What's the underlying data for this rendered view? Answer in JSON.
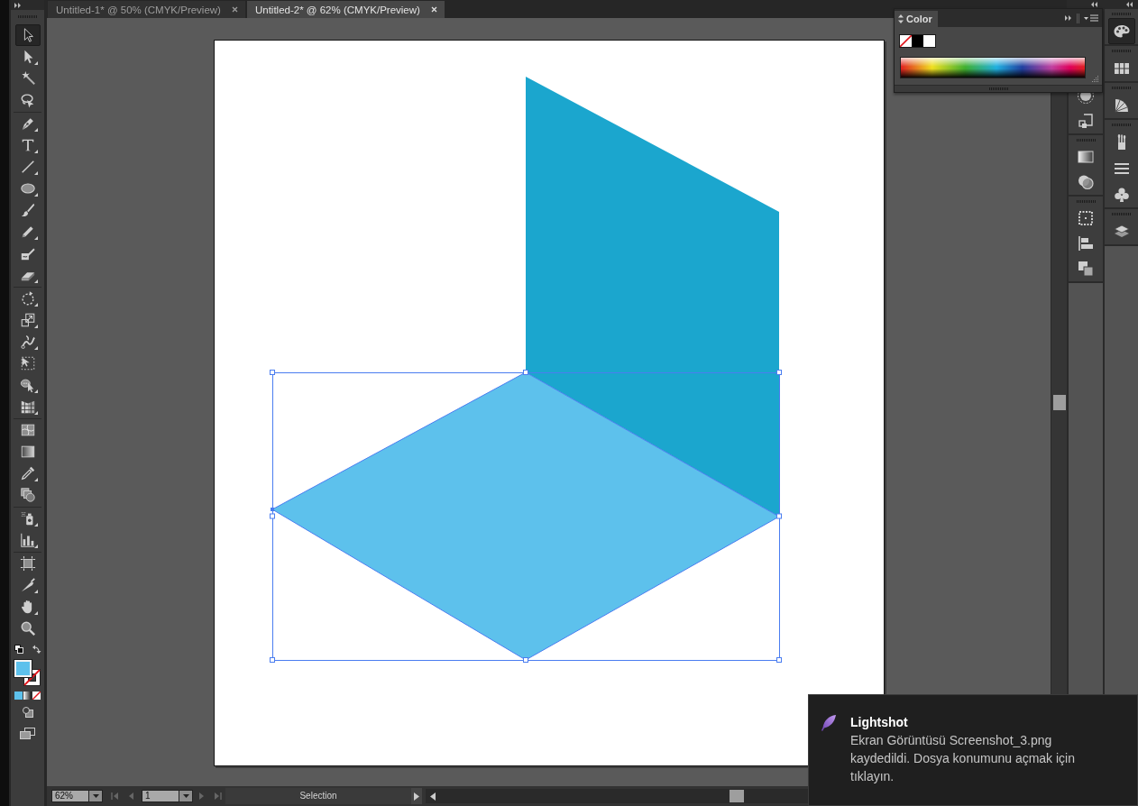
{
  "toolbar": {
    "groups": [
      {
        "tools": [
          {
            "kind": "selection",
            "selected": true,
            "flyout": false
          },
          {
            "kind": "direct",
            "selected": false,
            "flyout": true
          },
          {
            "kind": "magic_wand",
            "selected": false,
            "flyout": false
          },
          {
            "kind": "lasso",
            "selected": false,
            "flyout": false
          }
        ]
      },
      {
        "tools": [
          {
            "kind": "pen",
            "selected": false,
            "flyout": true
          },
          {
            "kind": "type",
            "selected": false,
            "flyout": true
          },
          {
            "kind": "line",
            "selected": false,
            "flyout": true
          },
          {
            "kind": "ellipse",
            "selected": false,
            "flyout": true
          },
          {
            "kind": "paintbrush",
            "selected": false,
            "flyout": false
          },
          {
            "kind": "pencil",
            "selected": false,
            "flyout": true
          },
          {
            "kind": "blob_brush",
            "selected": false,
            "flyout": false
          },
          {
            "kind": "eraser",
            "selected": false,
            "flyout": true
          }
        ]
      },
      {
        "tools": [
          {
            "kind": "rotate",
            "selected": false,
            "flyout": true
          },
          {
            "kind": "scale",
            "selected": false,
            "flyout": true
          },
          {
            "kind": "warp",
            "selected": false,
            "flyout": true
          },
          {
            "kind": "free_transform",
            "selected": false,
            "flyout": false
          },
          {
            "kind": "shape_builder",
            "selected": false,
            "flyout": true
          },
          {
            "kind": "perspective_grid",
            "selected": false,
            "flyout": true
          }
        ]
      },
      {
        "tools": [
          {
            "kind": "mesh",
            "selected": false,
            "flyout": false
          },
          {
            "kind": "gradient",
            "selected": false,
            "flyout": false
          },
          {
            "kind": "eyedropper",
            "selected": false,
            "flyout": true
          },
          {
            "kind": "blend",
            "selected": false,
            "flyout": false
          }
        ]
      },
      {
        "tools": [
          {
            "kind": "symbol_sprayer",
            "selected": false,
            "flyout": true
          },
          {
            "kind": "column_graph",
            "selected": false,
            "flyout": true
          }
        ]
      },
      {
        "tools": [
          {
            "kind": "artboard",
            "selected": false,
            "flyout": false
          },
          {
            "kind": "slice",
            "selected": false,
            "flyout": true
          },
          {
            "kind": "hand",
            "selected": false,
            "flyout": true
          },
          {
            "kind": "zoom",
            "selected": false,
            "flyout": false
          }
        ]
      }
    ],
    "fill": {
      "kind": "color",
      "color": "#5dc1ec"
    },
    "stroke": {
      "kind": "none"
    }
  },
  "tabs": [
    {
      "label": "Untitled-1* @ 50% (CMYK/Preview)",
      "selected": false
    },
    {
      "label": "Untitled-2* @ 62% (CMYK/Preview)",
      "selected": true
    }
  ],
  "artwork": {
    "shapes": [
      {
        "kind": "parallelogram",
        "color": "#1ba6ce",
        "selected": false
      },
      {
        "kind": "rhombus",
        "color": "#5dc1ec",
        "selected": true
      }
    ]
  },
  "color_panel": {
    "title": "Color",
    "swatches": [
      {
        "kind": "none"
      },
      {
        "kind": "color",
        "color": "#000000"
      },
      {
        "kind": "color",
        "color": "#ffffff"
      }
    ]
  },
  "docks": [
    {
      "groups": [
        {
          "icons": [
            {
              "kind": "appearance",
              "selected": false
            },
            {
              "kind": "transform",
              "selected": false
            }
          ]
        },
        {
          "icons": [
            {
              "kind": "gradient",
              "selected": false
            },
            {
              "kind": "transparency",
              "selected": false
            }
          ]
        },
        {
          "icons": [
            {
              "kind": "artboards",
              "selected": false
            },
            {
              "kind": "align",
              "selected": false
            },
            {
              "kind": "pathfinder",
              "selected": false
            }
          ]
        }
      ]
    },
    {
      "groups": [
        {
          "icons": [
            {
              "kind": "color",
              "selected": true
            }
          ]
        },
        {
          "icons": [
            {
              "kind": "swatches",
              "selected": false
            }
          ]
        },
        {
          "icons": [
            {
              "kind": "color_guide",
              "selected": false
            }
          ]
        },
        {
          "icons": [
            {
              "kind": "brushes",
              "selected": false
            },
            {
              "kind": "stroke",
              "selected": false
            },
            {
              "kind": "symbols",
              "selected": false
            }
          ]
        },
        {
          "icons": [
            {
              "kind": "layers",
              "selected": false
            }
          ]
        }
      ]
    }
  ],
  "status_bar": {
    "zoom": "62%",
    "page": "1",
    "nav_buttons": [
      {
        "kind": "first",
        "disabled": true
      },
      {
        "kind": "previous",
        "disabled": true
      },
      {
        "kind": "next",
        "disabled": true
      },
      {
        "kind": "last",
        "disabled": true
      }
    ],
    "status": "Selection"
  },
  "notification": {
    "app": "Lightshot",
    "message": "Ekran Görüntüsü Screenshot_3.png kaydedildi. Dosya konumunu açmak için tıklayın."
  }
}
